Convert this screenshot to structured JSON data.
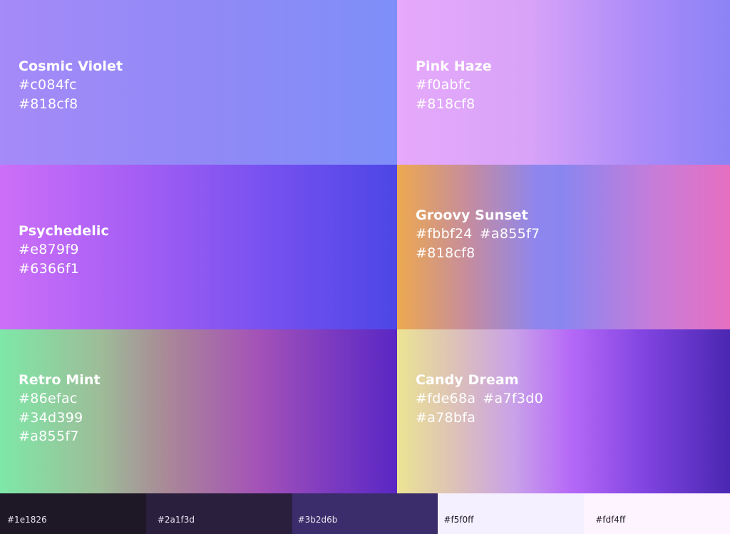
{
  "gradients": [
    {
      "name": "Cosmic Violet",
      "hex_line1": [
        "#c084fc"
      ],
      "hex_line2": [
        "#818cf8"
      ],
      "hex_line3": [],
      "colors": [
        "#c084fc",
        "#818cf8"
      ]
    },
    {
      "name": "Pink Haze",
      "hex_line1": [
        "#f0abfc"
      ],
      "hex_line2": [
        "#818cf8"
      ],
      "hex_line3": [],
      "colors": [
        "#f0abfc",
        "#818cf8"
      ]
    },
    {
      "name": "Psychedelic",
      "hex_line1": [
        "#e879f9"
      ],
      "hex_line2": [
        "#6366f1"
      ],
      "hex_line3": [],
      "colors": [
        "#e879f9",
        "#6366f1"
      ]
    },
    {
      "name": "Groovy Sunset",
      "hex_line1": [
        "#fbbf24",
        "#a855f7"
      ],
      "hex_line2": [
        "#818cf8"
      ],
      "hex_line3": [],
      "colors": [
        "#fbbf24",
        "#a855f7",
        "#818cf8"
      ]
    },
    {
      "name": "Retro Mint",
      "hex_line1": [
        "#86efac"
      ],
      "hex_line2": [
        "#34d399"
      ],
      "hex_line3": [
        "#a855f7"
      ],
      "colors": [
        "#86efac",
        "#34d399",
        "#a855f7"
      ]
    },
    {
      "name": "Candy Dream",
      "hex_line1": [
        "#fde68a",
        "#a7f3d0"
      ],
      "hex_line2": [
        "#a78bfa"
      ],
      "hex_line3": [],
      "colors": [
        "#fde68a",
        "#a7f3d0",
        "#a78bfa"
      ]
    }
  ],
  "swatches": [
    {
      "label": "#1e1826",
      "color": "#1e1826",
      "text_color": "#e8e4f0"
    },
    {
      "label": "#2a1f3d",
      "color": "#2a1f3d",
      "text_color": "#e8e4f0"
    },
    {
      "label": "#3b2d6b",
      "color": "#3b2d6b",
      "text_color": "#e8e4f0"
    },
    {
      "label": "#f5f0ff",
      "color": "#f5f0ff",
      "text_color": "#1e1826"
    },
    {
      "label": "#fdf4ff",
      "color": "#fdf4ff",
      "text_color": "#1e1826"
    }
  ]
}
